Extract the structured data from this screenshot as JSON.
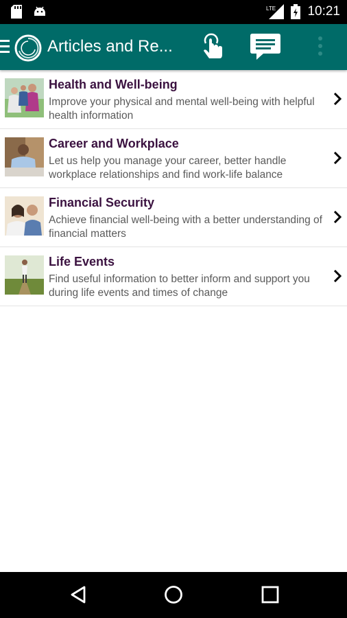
{
  "status_bar": {
    "time": "10:21",
    "network": "LTE",
    "icons": [
      "sd-card-icon",
      "android-icon",
      "signal-icon",
      "battery-icon"
    ]
  },
  "app_bar": {
    "title": "Articles and Re...",
    "icons": [
      "menu-icon",
      "logo-icon",
      "touch-icon",
      "chat-icon",
      "more-vert-icon"
    ]
  },
  "articles": [
    {
      "title": "Health and Well-being",
      "description": "Improve your physical and mental well-being with helpful health information",
      "thumbnail": "health-photo"
    },
    {
      "title": "Career and Workplace",
      "description": "Let us help you manage your career, better handle workplace relationships and find work-life balance",
      "thumbnail": "career-photo"
    },
    {
      "title": "Financial Security",
      "description": "Achieve financial well-being with a better understanding of financial matters",
      "thumbnail": "finance-photo"
    },
    {
      "title": "Life Events",
      "description": "Find useful information to better inform and support you during life events and times of change",
      "thumbnail": "life-events-photo"
    }
  ],
  "nav_bar": {
    "icons": [
      "back-icon",
      "home-icon",
      "recents-icon"
    ]
  },
  "colors": {
    "app_bar": "#006b68",
    "title_text": "#3b1240",
    "desc_text": "#5a5a5a"
  }
}
